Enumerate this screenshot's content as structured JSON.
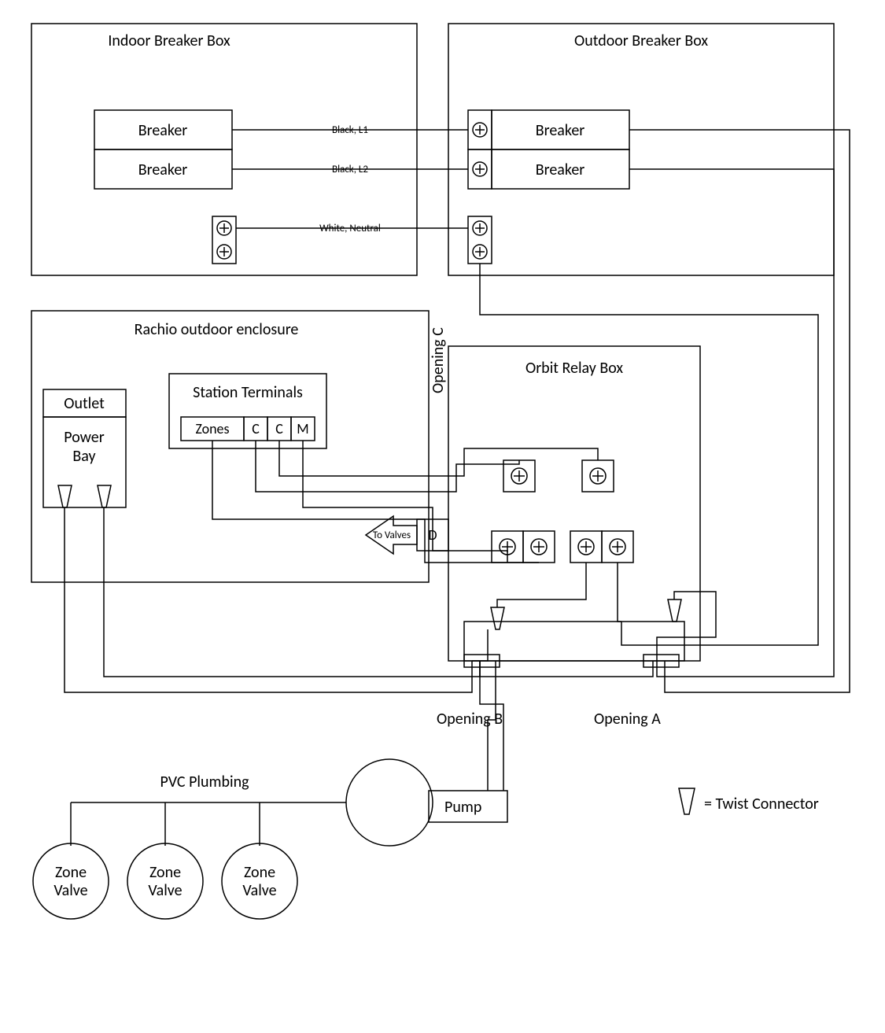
{
  "boxes": {
    "indoor_breaker": "Indoor Breaker Box",
    "outdoor_breaker": "Outdoor Breaker Box",
    "rachio": "Rachio outdoor enclosure",
    "orbit": "Orbit Relay Box",
    "outlet": "Outlet",
    "power_bay_l1": "Power",
    "power_bay_l2": "Bay",
    "station_terminals": "Station Terminals",
    "breaker": "Breaker"
  },
  "wires": {
    "l1": "Black, L1",
    "l2": "Black, L2",
    "neutral": "White, Neutral"
  },
  "terminals": {
    "zones": "Zones",
    "c1": "C",
    "c2": "C",
    "m": "M"
  },
  "openings": {
    "a": "Opening A",
    "b": "Opening B",
    "c": "Opening C",
    "d": "D"
  },
  "arrow_label": "To Valves",
  "plumbing": {
    "pvc": "PVC Plumbing",
    "pump": "Pump",
    "zone_valve_l1": "Zone",
    "zone_valve_l2": "Valve"
  },
  "legend": "= Twist Connector"
}
